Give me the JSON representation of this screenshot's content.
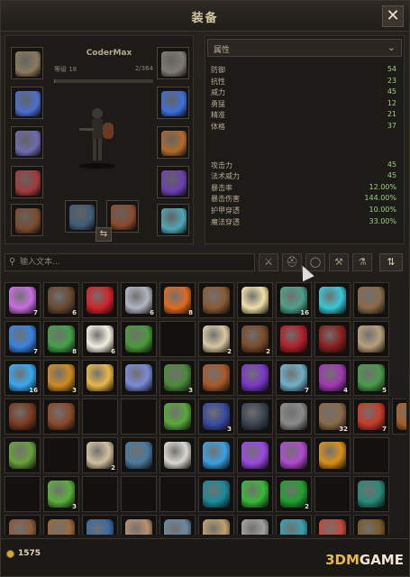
{
  "window": {
    "title": "装备",
    "close_glyph": "✕"
  },
  "character": {
    "name": "CoderMax",
    "level_label": "等级 18",
    "xp_text": "2/364",
    "xp_fraction": 0.005
  },
  "equipment_slots": [
    {
      "name": "helmet",
      "icon": "helmet-icon",
      "color": "#8b7a5c"
    },
    {
      "name": "amulet",
      "icon": "blue-flower-amulet-icon",
      "color": "#4b6fd0"
    },
    {
      "name": "chest",
      "icon": "chest-armor-icon",
      "color": "#6d6bb0"
    },
    {
      "name": "belt",
      "icon": "red-belt-icon",
      "color": "#a23a3a"
    },
    {
      "name": "boots",
      "icon": "boots-icon",
      "color": "#7a4a2c"
    },
    {
      "name": "gloves",
      "icon": "gauntlet-icon",
      "color": "#7f7a72"
    },
    {
      "name": "ring-left",
      "icon": "sapphire-ring-icon",
      "color": "#3d6fd9"
    },
    {
      "name": "ring-right",
      "icon": "bronze-ring-icon",
      "color": "#b06a2a"
    },
    {
      "name": "trinket",
      "icon": "purple-orb-icon",
      "color": "#6b3fb0"
    },
    {
      "name": "offhand",
      "icon": "horn-icon",
      "color": "#4fa7b8"
    },
    {
      "name": "main-weapon",
      "icon": "musket-icon",
      "color": "#3e5d78"
    },
    {
      "name": "offhand-weapon",
      "icon": "wooden-shield-icon",
      "color": "#8a4a2e"
    }
  ],
  "stats": {
    "dropdown_label": "属性",
    "groups": [
      [
        {
          "key": "防御",
          "value": "54"
        },
        {
          "key": "抗性",
          "value": "23"
        },
        {
          "key": "威力",
          "value": "45"
        },
        {
          "key": "勇猛",
          "value": "12"
        },
        {
          "key": "精准",
          "value": "21"
        },
        {
          "key": "体格",
          "value": "37"
        }
      ],
      [
        {
          "key": "攻击力",
          "value": "45"
        },
        {
          "key": "法术威力",
          "value": "45"
        },
        {
          "key": "暴击率",
          "value": "12.00%"
        },
        {
          "key": "暴击伤害",
          "value": "144.00%"
        },
        {
          "key": "护甲穿透",
          "value": "10.00%"
        },
        {
          "key": "魔法穿透",
          "value": "33.00%"
        }
      ]
    ]
  },
  "search": {
    "placeholder": "输入文本..."
  },
  "filters": [
    {
      "name": "weapon-filter",
      "icon": "sword-icon",
      "glyph": "⚔"
    },
    {
      "name": "armor-filter",
      "icon": "helmet-filter-icon",
      "glyph": "⛑"
    },
    {
      "name": "ring-filter",
      "icon": "ring-icon",
      "glyph": "◯"
    },
    {
      "name": "tool-filter",
      "icon": "hammer-icon",
      "glyph": "⚒"
    },
    {
      "name": "consumable-filter",
      "icon": "potion-icon",
      "glyph": "⚗"
    }
  ],
  "sort_glyph": "⇅",
  "inventory": [
    [
      {
        "c": "#c86fe0",
        "n": "7"
      },
      {
        "c": "#6a4a32",
        "n": "6"
      },
      {
        "c": "#d0242a",
        "n": ""
      },
      {
        "c": "#b0b6c0",
        "n": "6"
      },
      {
        "c": "#e06a20",
        "n": "8"
      },
      {
        "c": "#8a5a34",
        "n": ""
      },
      {
        "c": "#f0e0a8",
        "n": ""
      },
      {
        "c": "#4ca08a",
        "n": "16"
      },
      {
        "c": "#36c8d6",
        "n": ""
      },
      {
        "c": "#8a6a48",
        "n": ""
      }
    ],
    [
      {
        "c": "#3a82e0",
        "n": "7"
      },
      {
        "c": "#44a048",
        "n": "8"
      },
      {
        "c": "#f0f0e0",
        "n": "6"
      },
      {
        "c": "#4a9a3a",
        "n": ""
      },
      {
        "c": "",
        "n": ""
      },
      {
        "c": "#d8c8a0",
        "n": "2"
      },
      {
        "c": "#7a4a2a",
        "n": "2"
      },
      {
        "c": "#b0202a",
        "n": ""
      },
      {
        "c": "#8a2020",
        "n": ""
      },
      {
        "c": "#b8a07a",
        "n": ""
      }
    ],
    [
      {
        "c": "#38a8f0",
        "n": "16"
      },
      {
        "c": "#d08a20",
        "n": "3"
      },
      {
        "c": "#e8b848",
        "n": ""
      },
      {
        "c": "#7a8ad8",
        "n": ""
      },
      {
        "c": "#4a8a3a",
        "n": "3"
      },
      {
        "c": "#a85a28",
        "n": ""
      },
      {
        "c": "#7a38c8",
        "n": ""
      },
      {
        "c": "#70b0c8",
        "n": "7"
      },
      {
        "c": "#a03ab0",
        "n": "4"
      },
      {
        "c": "#4a9a4a",
        "n": "5"
      }
    ],
    [
      {
        "c": "#7a3a20",
        "n": ""
      },
      {
        "c": "#8a4a2a",
        "n": ""
      },
      {
        "c": "",
        "n": ""
      },
      {
        "c": "",
        "n": ""
      },
      {
        "c": "#5aa83a",
        "n": ""
      },
      {
        "c": "#3a4aa0",
        "n": "3"
      },
      {
        "c": "#3a4450",
        "n": ""
      },
      {
        "c": "#8a8a8a",
        "n": ""
      },
      {
        "c": "#8a6a4a",
        "n": "32"
      },
      {
        "c": "#c83a2a",
        "n": "7"
      },
      {
        "c": "#a8602a",
        "n": ""
      }
    ],
    [
      {
        "c": "#6aa03a",
        "n": ""
      },
      {
        "c": "",
        "n": ""
      },
      {
        "c": "#d0c0a0",
        "n": "2"
      },
      {
        "c": "#4a7a9a",
        "n": ""
      },
      {
        "c": "#d8d8d0",
        "n": ""
      },
      {
        "c": "#3aa0e0",
        "n": ""
      },
      {
        "c": "#9a4ae0",
        "n": ""
      },
      {
        "c": "#b04ad0",
        "n": ""
      },
      {
        "c": "#d8901a",
        "n": ""
      },
      {
        "c": "",
        "n": ""
      }
    ],
    [
      {
        "c": "",
        "n": ""
      },
      {
        "c": "#5ab03a",
        "n": "3"
      },
      {
        "c": "",
        "n": ""
      },
      {
        "c": "",
        "n": ""
      },
      {
        "c": "",
        "n": ""
      },
      {
        "c": "#1a8a9a",
        "n": ""
      },
      {
        "c": "#38b838",
        "n": ""
      },
      {
        "c": "#20a030",
        "n": "2"
      },
      {
        "c": "",
        "n": ""
      },
      {
        "c": "#2a8a7a",
        "n": ""
      }
    ],
    [
      {
        "c": "#8a5a3a",
        "n": ""
      },
      {
        "c": "#9a6a3a",
        "n": ""
      },
      {
        "c": "#3a6aa0",
        "n": ""
      },
      {
        "c": "#b89070",
        "n": ""
      },
      {
        "c": "#6a8aa0",
        "n": ""
      },
      {
        "c": "#c0a06a",
        "n": ""
      },
      {
        "c": "#a0a0a0",
        "n": ""
      },
      {
        "c": "#3aa0b0",
        "n": ""
      },
      {
        "c": "#c04a3a",
        "n": ""
      },
      {
        "c": "#7a5a2a",
        "n": ""
      }
    ]
  ],
  "footer": {
    "gold": "1575",
    "watermark_prefix": "3DM",
    "watermark_suffix": "GAME"
  }
}
